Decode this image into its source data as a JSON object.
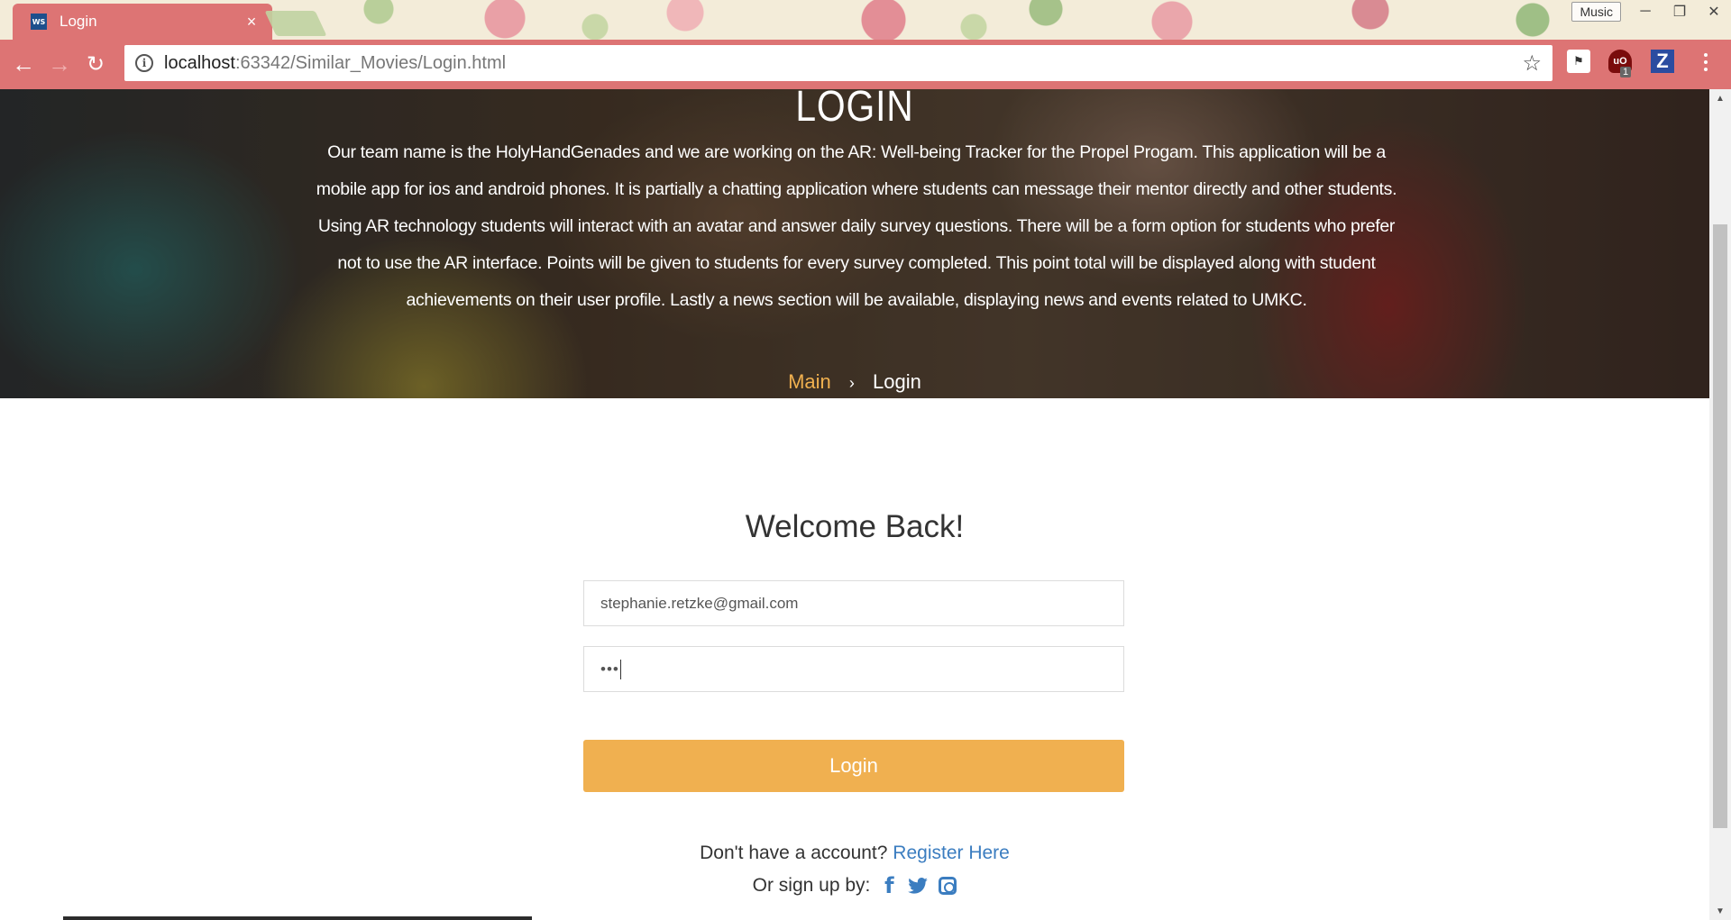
{
  "browser": {
    "tab_title": "Login",
    "favicon_text": "WS",
    "tab_close": "×",
    "music_label": "Music",
    "url_host": "localhost",
    "url_rest": ":63342/Similar_Movies/Login.html",
    "extension_badge": "1",
    "ext_ublock": "uO",
    "ext_z": "Z"
  },
  "hero": {
    "title": "LOGIN",
    "description": "Our team name is the HolyHandGenades and we are working on the AR: Well-being Tracker for the Propel Progam. This application will be a mobile app for ios and android phones. It is partially a chatting application where students can message their mentor directly and other students. Using AR technology students will interact with an avatar and answer daily survey questions. There will be a form option for students who prefer not to use the AR interface. Points will be given to students for every survey completed. This point total will be displayed along with student achievements on their user profile. Lastly a news section will be available, displaying news and events related to UMKC.",
    "breadcrumb": {
      "main": "Main",
      "separator": "›",
      "current": "Login"
    }
  },
  "form": {
    "heading": "Welcome Back!",
    "email_value": "stephanie.retzke@gmail.com",
    "password_value": "•••",
    "login_label": "Login",
    "register_prompt": "Don't have a account?",
    "register_link": "Register Here",
    "signup_prompt": "Or sign up by:"
  },
  "icons": {
    "facebook": "facebook-icon",
    "twitter": "twitter-icon",
    "instagram": "instagram-icon"
  },
  "colors": {
    "chrome_accent": "#dd7474",
    "login_button": "#f0b050",
    "breadcrumb_main": "#f0b04f",
    "link": "#3b7dc0"
  }
}
